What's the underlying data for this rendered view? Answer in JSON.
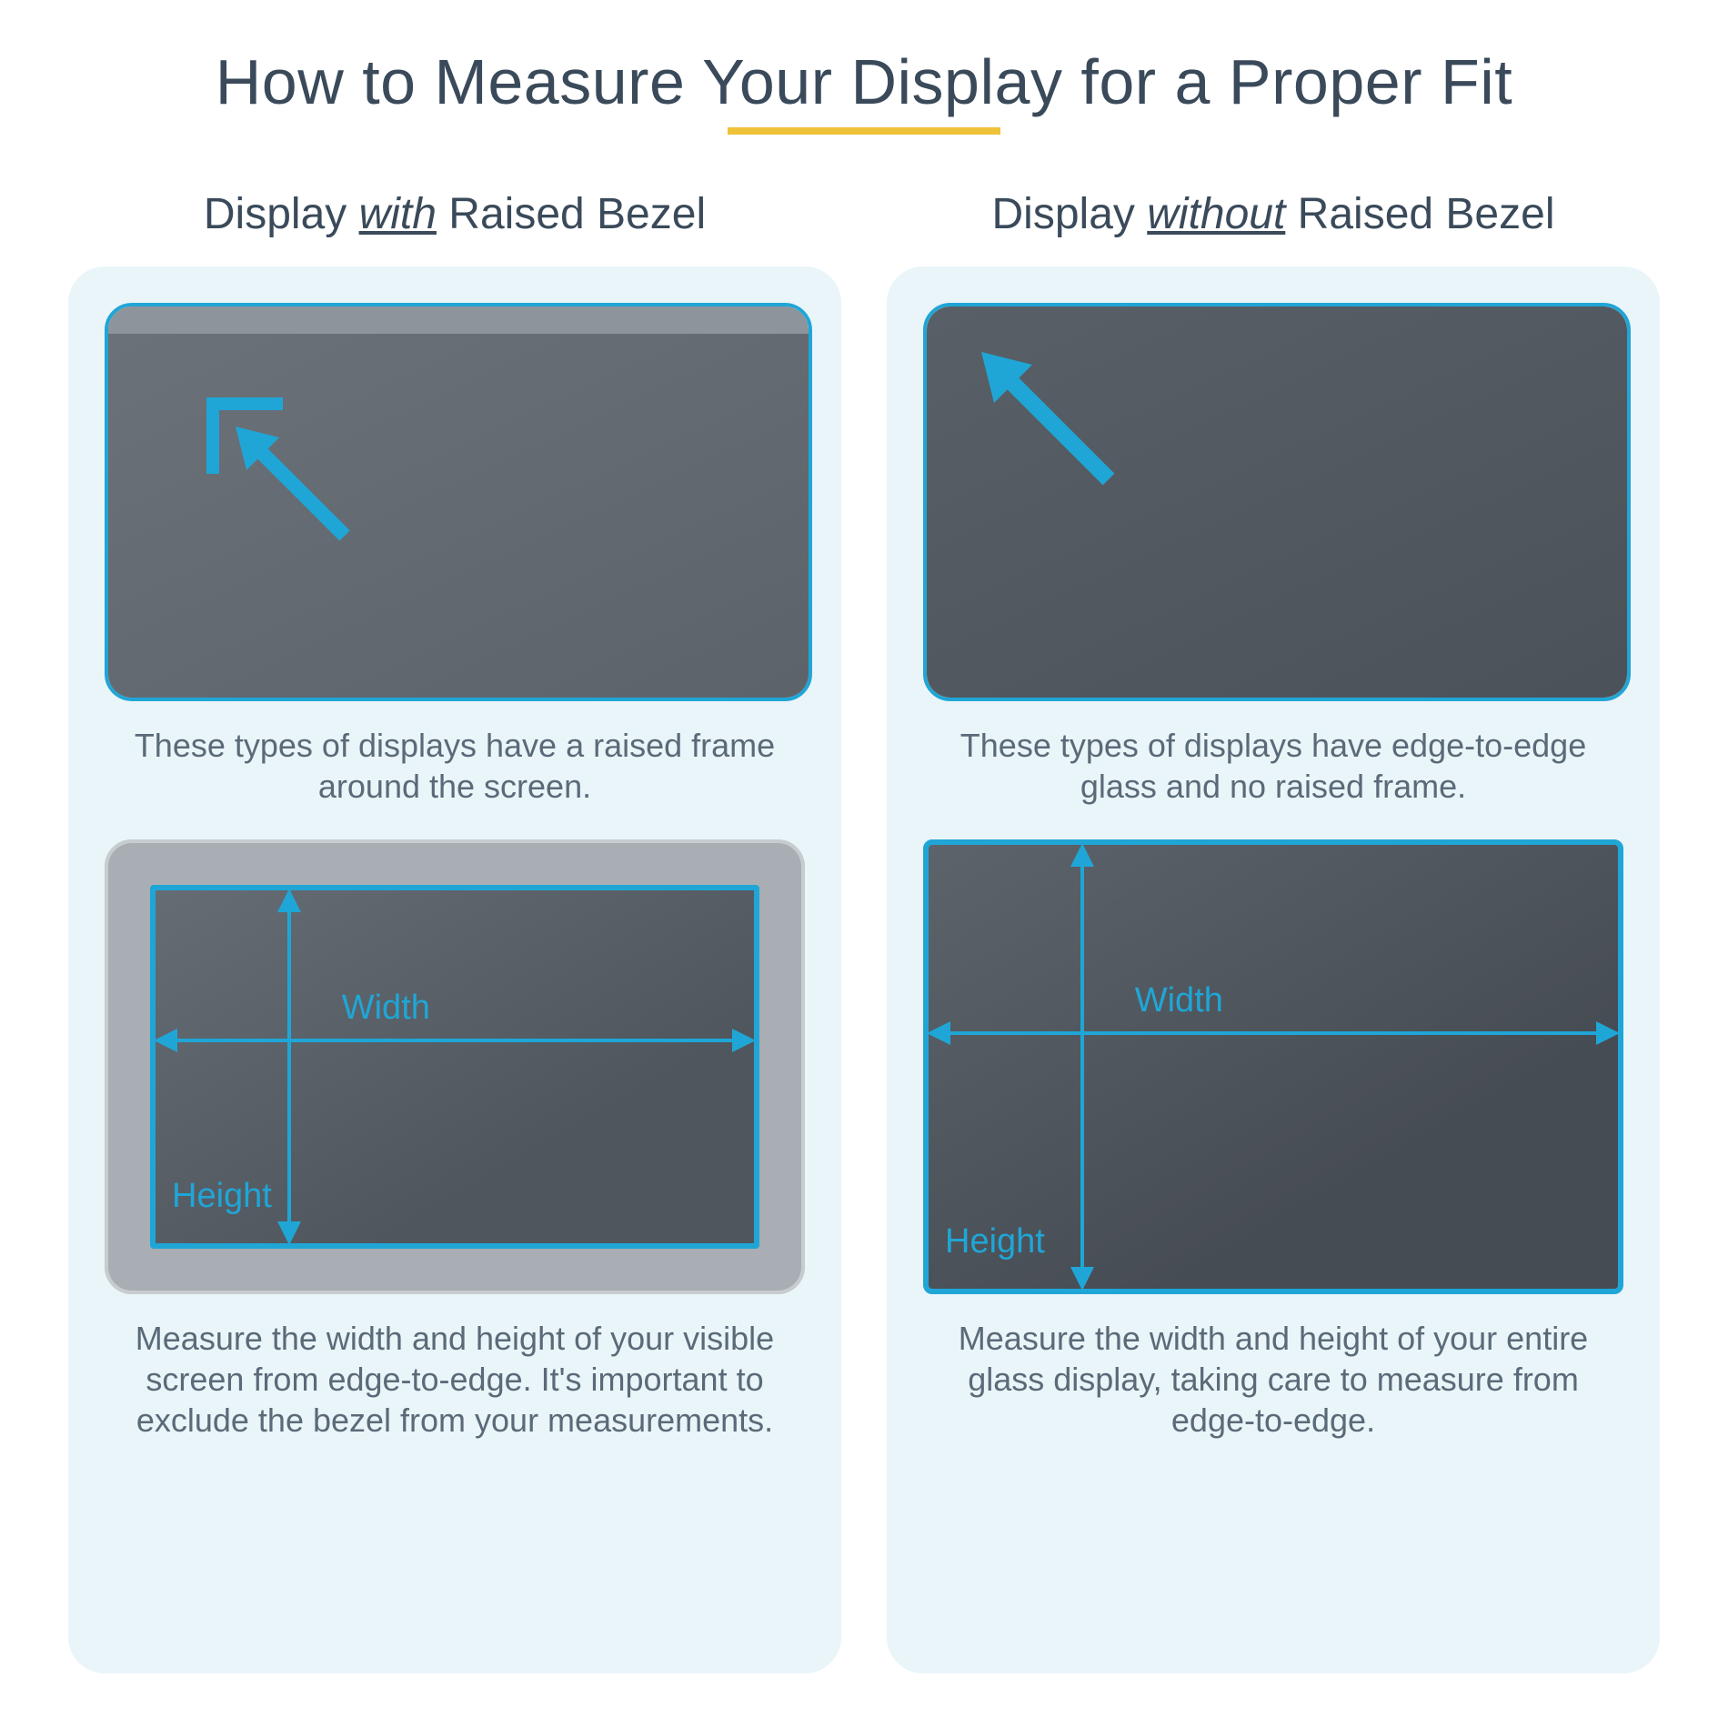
{
  "title": "How to Measure Your Display for a Proper Fit",
  "columns": {
    "left": {
      "heading_pre": "Display ",
      "heading_emph": "with",
      "heading_post": " Raised Bezel",
      "top_desc": "These types of displays have a raised frame around the screen.",
      "bottom_desc": "Measure the width and height of your visible screen from edge-to-edge. It's important to exclude the bezel from your measurements."
    },
    "right": {
      "heading_pre": "Display ",
      "heading_emph": "without",
      "heading_post": " Raised Bezel",
      "top_desc": "These types of displays have edge-to-edge glass and no raised frame.",
      "bottom_desc": "Measure the width and height of your entire glass display, taking care to measure from edge-to-edge."
    }
  },
  "labels": {
    "width": "Width",
    "height": "Height"
  },
  "colors": {
    "accent": "#1fa6d6",
    "underline": "#f0c23a",
    "card_bg": "#eaf5f9",
    "text": "#3a4a5a"
  }
}
